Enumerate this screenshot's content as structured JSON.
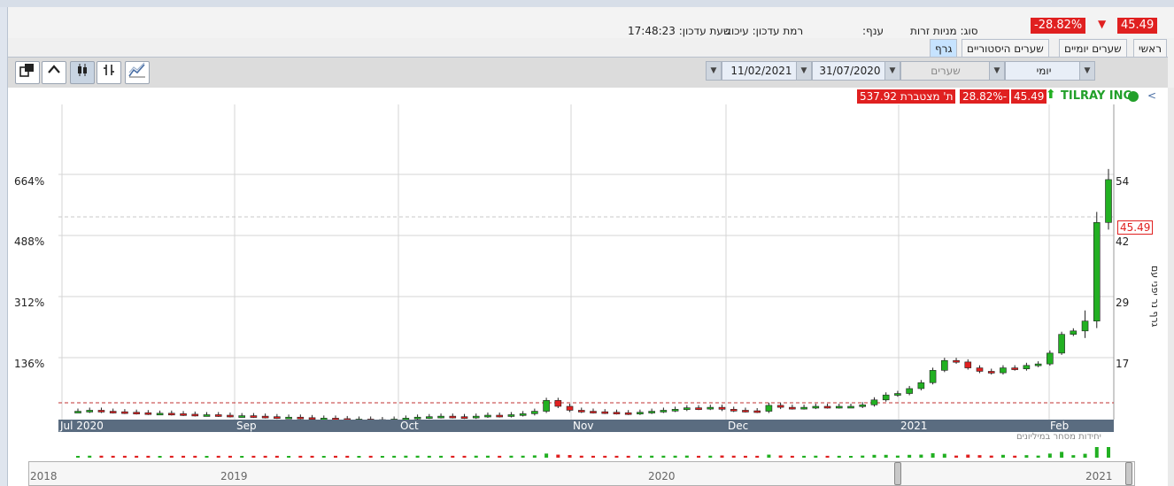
{
  "header": {
    "price": "45.49",
    "change_pct": "-28.82%",
    "type_label": "סוג: מניות זרות",
    "branch_label": "ענף:",
    "update_time_label": "שעת עדכון: 17:48:23",
    "update_level_label": "רמת עדכון: עיכוב",
    "down_arrow": "▼"
  },
  "tabs": [
    {
      "label": "ראשי"
    },
    {
      "label": "שערים יומיים"
    },
    {
      "label": "שערים היסטוריים"
    },
    {
      "label": "גרף"
    }
  ],
  "toolbar": {
    "period_select": "יומי",
    "data_select": "שערים",
    "from_date": "31/07/2020",
    "to_date": "11/02/2021"
  },
  "chart_header": {
    "ticker": "TILRAY INC",
    "price": "45.49",
    "change": "-28.82%",
    "cumulative": "ת' מצטברת 537.92",
    "up_arrow": "⬆",
    "collapse": "<"
  },
  "chart_data": {
    "type": "candlestick",
    "x_labels": [
      "Jul 2020",
      "Sep",
      "Oct",
      "Nov",
      "Dec",
      "2021",
      "Feb"
    ],
    "left_axis_ticks": [
      "664%",
      "488%",
      "312%",
      "136%"
    ],
    "right_axis_ticks": [
      "54",
      "42",
      "29",
      "17"
    ],
    "last_price_tag": "45.49",
    "right_axis_title": "גרף נר יפני עם",
    "volume_note": "יחידות מסחר במיליונים",
    "navigator_labels": [
      "2018",
      "2019",
      "2020",
      "2021"
    ],
    "closes": [
      7.2,
      7.4,
      7.2,
      7.1,
      7.0,
      6.9,
      6.8,
      6.8,
      6.7,
      6.6,
      6.5,
      6.5,
      6.4,
      6.3,
      6.3,
      6.2,
      6.1,
      6.0,
      6.0,
      5.9,
      5.8,
      5.8,
      5.7,
      5.6,
      5.6,
      5.5,
      5.5,
      5.6,
      5.8,
      6.0,
      6.1,
      6.2,
      6.1,
      6.0,
      6.2,
      6.4,
      6.3,
      6.5,
      6.7,
      7.2,
      9.4,
      8.2,
      7.4,
      7.2,
      7.1,
      7.0,
      6.9,
      6.8,
      7.0,
      7.2,
      7.4,
      7.6,
      7.9,
      7.8,
      8.0,
      7.6,
      7.4,
      7.3,
      7.2,
      8.4,
      8.0,
      7.9,
      8.0,
      8.2,
      8.1,
      8.2,
      8.2,
      8.5,
      9.5,
      10.5,
      10.8,
      11.8,
      13.0,
      15.5,
      17.5,
      17.2,
      16.0,
      15.3,
      15.0,
      16.0,
      15.8,
      16.5,
      16.8,
      19.0,
      22.8,
      23.5,
      25.5,
      45.5,
      54.2
    ]
  },
  "colors": {
    "up": "#22b022",
    "down": "#e02020",
    "axis_band": "#5a6c80",
    "grid": "#d4d4d4"
  }
}
